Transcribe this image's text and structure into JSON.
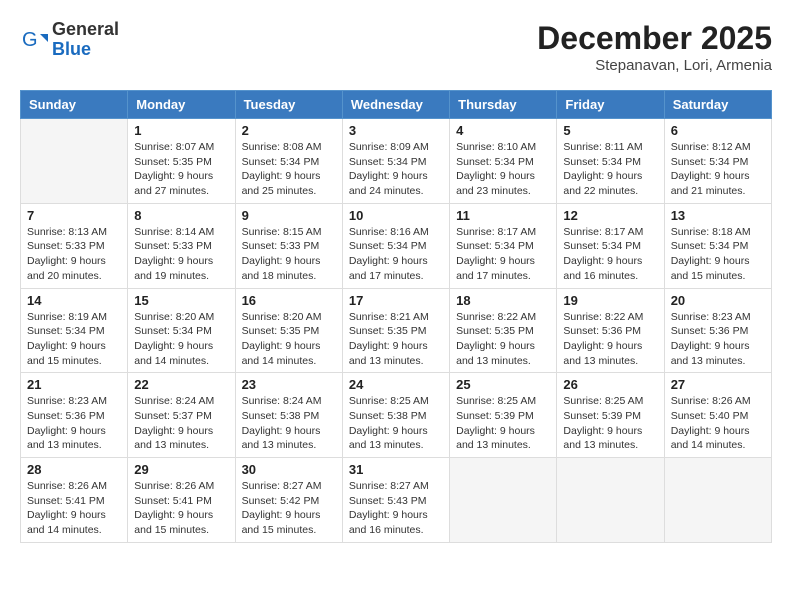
{
  "header": {
    "logo_general": "General",
    "logo_blue": "Blue",
    "month_year": "December 2025",
    "location": "Stepanavan, Lori, Armenia"
  },
  "weekdays": [
    "Sunday",
    "Monday",
    "Tuesday",
    "Wednesday",
    "Thursday",
    "Friday",
    "Saturday"
  ],
  "weeks": [
    [
      {
        "day": "",
        "info": ""
      },
      {
        "day": "1",
        "info": "Sunrise: 8:07 AM\nSunset: 5:35 PM\nDaylight: 9 hours\nand 27 minutes."
      },
      {
        "day": "2",
        "info": "Sunrise: 8:08 AM\nSunset: 5:34 PM\nDaylight: 9 hours\nand 25 minutes."
      },
      {
        "day": "3",
        "info": "Sunrise: 8:09 AM\nSunset: 5:34 PM\nDaylight: 9 hours\nand 24 minutes."
      },
      {
        "day": "4",
        "info": "Sunrise: 8:10 AM\nSunset: 5:34 PM\nDaylight: 9 hours\nand 23 minutes."
      },
      {
        "day": "5",
        "info": "Sunrise: 8:11 AM\nSunset: 5:34 PM\nDaylight: 9 hours\nand 22 minutes."
      },
      {
        "day": "6",
        "info": "Sunrise: 8:12 AM\nSunset: 5:34 PM\nDaylight: 9 hours\nand 21 minutes."
      }
    ],
    [
      {
        "day": "7",
        "info": "Sunrise: 8:13 AM\nSunset: 5:33 PM\nDaylight: 9 hours\nand 20 minutes."
      },
      {
        "day": "8",
        "info": "Sunrise: 8:14 AM\nSunset: 5:33 PM\nDaylight: 9 hours\nand 19 minutes."
      },
      {
        "day": "9",
        "info": "Sunrise: 8:15 AM\nSunset: 5:33 PM\nDaylight: 9 hours\nand 18 minutes."
      },
      {
        "day": "10",
        "info": "Sunrise: 8:16 AM\nSunset: 5:34 PM\nDaylight: 9 hours\nand 17 minutes."
      },
      {
        "day": "11",
        "info": "Sunrise: 8:17 AM\nSunset: 5:34 PM\nDaylight: 9 hours\nand 17 minutes."
      },
      {
        "day": "12",
        "info": "Sunrise: 8:17 AM\nSunset: 5:34 PM\nDaylight: 9 hours\nand 16 minutes."
      },
      {
        "day": "13",
        "info": "Sunrise: 8:18 AM\nSunset: 5:34 PM\nDaylight: 9 hours\nand 15 minutes."
      }
    ],
    [
      {
        "day": "14",
        "info": "Sunrise: 8:19 AM\nSunset: 5:34 PM\nDaylight: 9 hours\nand 15 minutes."
      },
      {
        "day": "15",
        "info": "Sunrise: 8:20 AM\nSunset: 5:34 PM\nDaylight: 9 hours\nand 14 minutes."
      },
      {
        "day": "16",
        "info": "Sunrise: 8:20 AM\nSunset: 5:35 PM\nDaylight: 9 hours\nand 14 minutes."
      },
      {
        "day": "17",
        "info": "Sunrise: 8:21 AM\nSunset: 5:35 PM\nDaylight: 9 hours\nand 13 minutes."
      },
      {
        "day": "18",
        "info": "Sunrise: 8:22 AM\nSunset: 5:35 PM\nDaylight: 9 hours\nand 13 minutes."
      },
      {
        "day": "19",
        "info": "Sunrise: 8:22 AM\nSunset: 5:36 PM\nDaylight: 9 hours\nand 13 minutes."
      },
      {
        "day": "20",
        "info": "Sunrise: 8:23 AM\nSunset: 5:36 PM\nDaylight: 9 hours\nand 13 minutes."
      }
    ],
    [
      {
        "day": "21",
        "info": "Sunrise: 8:23 AM\nSunset: 5:36 PM\nDaylight: 9 hours\nand 13 minutes."
      },
      {
        "day": "22",
        "info": "Sunrise: 8:24 AM\nSunset: 5:37 PM\nDaylight: 9 hours\nand 13 minutes."
      },
      {
        "day": "23",
        "info": "Sunrise: 8:24 AM\nSunset: 5:38 PM\nDaylight: 9 hours\nand 13 minutes."
      },
      {
        "day": "24",
        "info": "Sunrise: 8:25 AM\nSunset: 5:38 PM\nDaylight: 9 hours\nand 13 minutes."
      },
      {
        "day": "25",
        "info": "Sunrise: 8:25 AM\nSunset: 5:39 PM\nDaylight: 9 hours\nand 13 minutes."
      },
      {
        "day": "26",
        "info": "Sunrise: 8:25 AM\nSunset: 5:39 PM\nDaylight: 9 hours\nand 13 minutes."
      },
      {
        "day": "27",
        "info": "Sunrise: 8:26 AM\nSunset: 5:40 PM\nDaylight: 9 hours\nand 14 minutes."
      }
    ],
    [
      {
        "day": "28",
        "info": "Sunrise: 8:26 AM\nSunset: 5:41 PM\nDaylight: 9 hours\nand 14 minutes."
      },
      {
        "day": "29",
        "info": "Sunrise: 8:26 AM\nSunset: 5:41 PM\nDaylight: 9 hours\nand 15 minutes."
      },
      {
        "day": "30",
        "info": "Sunrise: 8:27 AM\nSunset: 5:42 PM\nDaylight: 9 hours\nand 15 minutes."
      },
      {
        "day": "31",
        "info": "Sunrise: 8:27 AM\nSunset: 5:43 PM\nDaylight: 9 hours\nand 16 minutes."
      },
      {
        "day": "",
        "info": ""
      },
      {
        "day": "",
        "info": ""
      },
      {
        "day": "",
        "info": ""
      }
    ]
  ]
}
